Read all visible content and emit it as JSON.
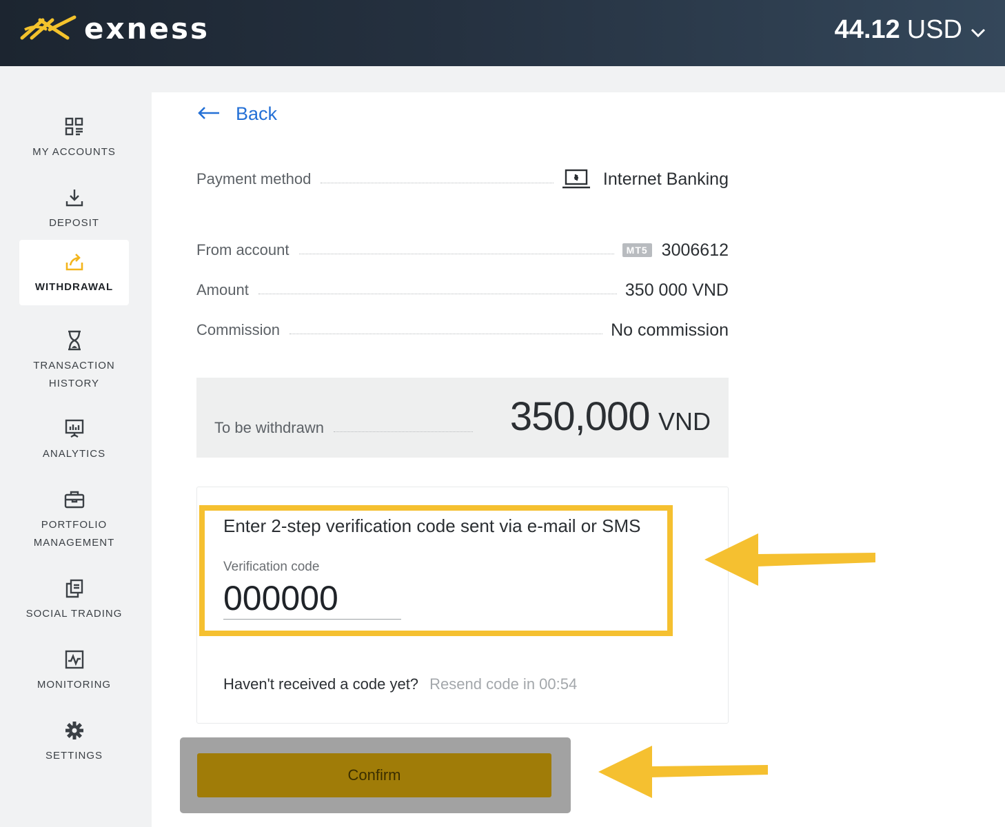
{
  "header": {
    "brand": "exness",
    "balance_amount": "44.12",
    "balance_currency": "USD"
  },
  "sidebar": {
    "items": [
      {
        "label": "MY ACCOUNTS",
        "icon": "accounts-grid-icon"
      },
      {
        "label": "DEPOSIT",
        "icon": "download-icon"
      },
      {
        "label": "WITHDRAWAL",
        "icon": "withdraw-icon",
        "active": true
      },
      {
        "label": "TRANSACTION\nHISTORY",
        "icon": "hourglass-icon"
      },
      {
        "label": "ANALYTICS",
        "icon": "presentation-chart-icon"
      },
      {
        "label": "PORTFOLIO\nMANAGEMENT",
        "icon": "briefcase-icon"
      },
      {
        "label": "SOCIAL TRADING",
        "icon": "copy-trade-icon"
      },
      {
        "label": "MONITORING",
        "icon": "pulse-chart-icon"
      },
      {
        "label": "SETTINGS",
        "icon": "gear-icon"
      }
    ]
  },
  "main": {
    "back_label": "Back",
    "details": {
      "payment_method_label": "Payment method",
      "payment_method_value": "Internet Banking",
      "from_account_label": "From account",
      "account_badge": "MT5",
      "from_account_value": "3006612",
      "amount_label": "Amount",
      "amount_value": "350 000 VND",
      "commission_label": "Commission",
      "commission_value": "No commission"
    },
    "total": {
      "label": "To be withdrawn",
      "amount": "350,000",
      "currency": "VND"
    },
    "verification": {
      "title": "Enter 2-step verification code sent via e-mail or SMS",
      "field_label": "Verification code",
      "code_value": "000000",
      "resend_question": "Haven't received a code yet?",
      "resend_timer": "Resend code in 00:54"
    },
    "confirm_label": "Confirm"
  },
  "colors": {
    "accent_yellow": "#f5c030",
    "link_blue": "#2470d6",
    "header_dark": "#1c2530",
    "confirm_button": "#a07c08"
  }
}
